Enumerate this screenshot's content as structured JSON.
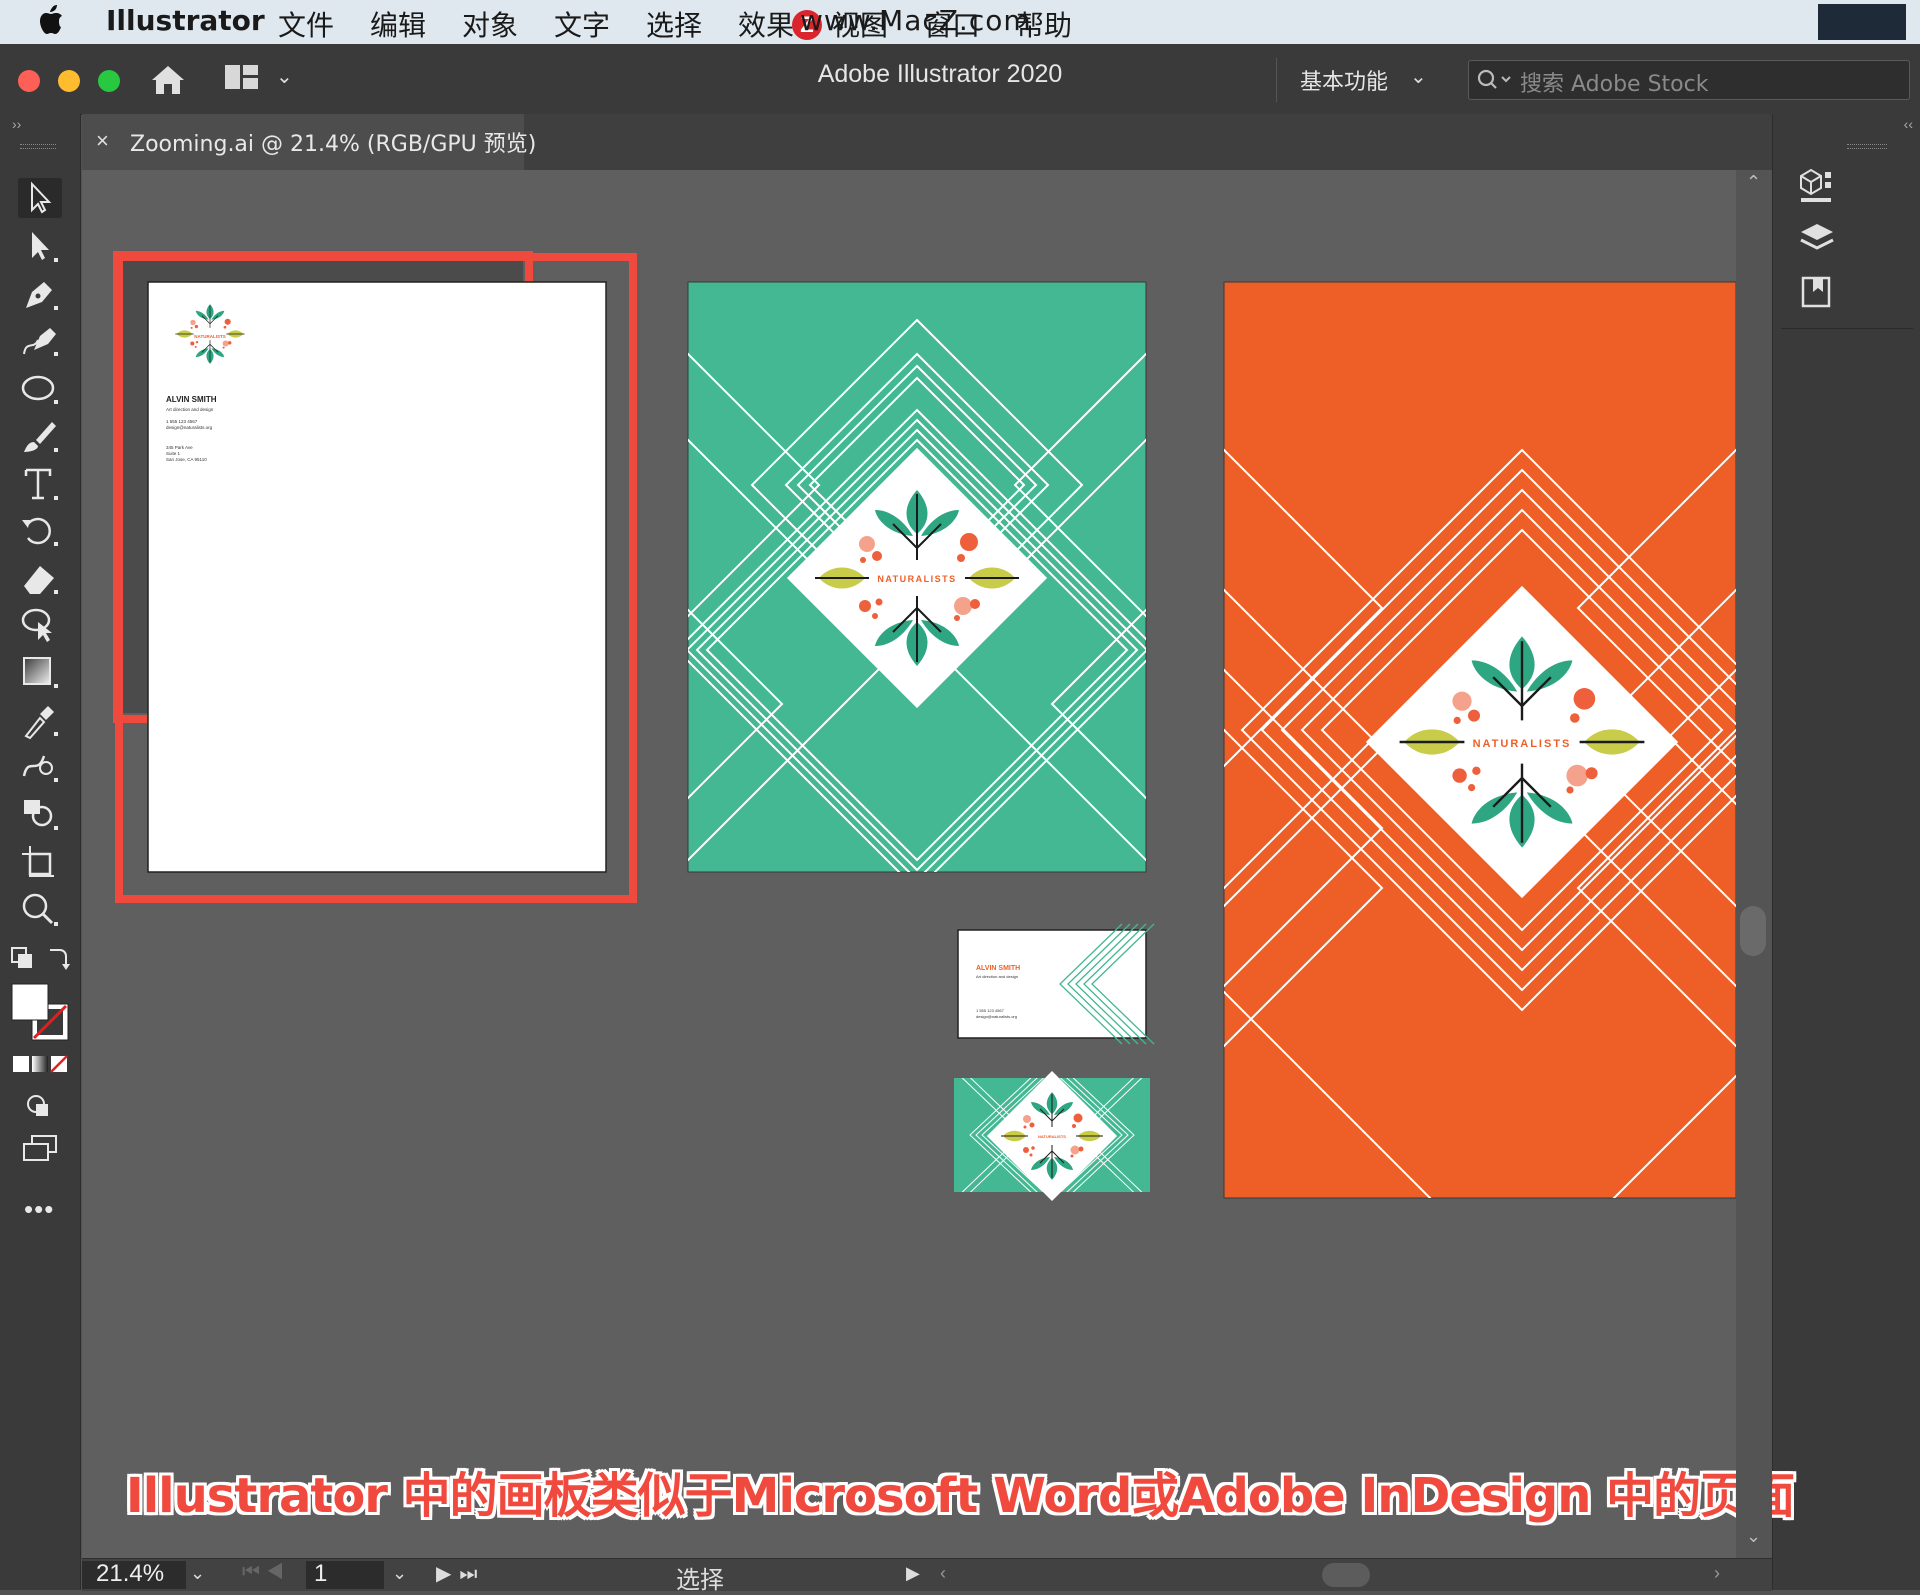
{
  "menubar": {
    "apple": "",
    "app_name": "Illustrator",
    "items": [
      "文件",
      "编辑",
      "对象",
      "文字",
      "选择",
      "效果",
      "视图",
      "窗口",
      "帮助"
    ],
    "watermark": "www.MacZ.com",
    "watermark_logo": "Z"
  },
  "titlebar": {
    "title": "Adobe Illustrator 2020",
    "workspace": "基本功能",
    "search_placeholder": "搜索 Adobe Stock"
  },
  "document_tab": {
    "close": "×",
    "label": "Zooming.ai @ 21.4% (RGB/GPU 预览)"
  },
  "artboards": {
    "letterhead": {
      "name": "ALVIN SMITH",
      "subtitle": "Art direction and design",
      "phone": "1 555 123 4567",
      "email": "design@naturalists.org",
      "address": [
        "345 Park Ave",
        "Suite 1",
        "San Jose, CA 95110"
      ]
    },
    "brand": "NATURALISTS",
    "business_card": {
      "name": "ALVIN SMITH",
      "subtitle": "Art direction and design",
      "phone": "1 555 123 4567",
      "email": "design@naturalists.org"
    }
  },
  "statusbar": {
    "zoom": "21.4%",
    "page": "1",
    "mode": "选择"
  },
  "caption": "Illustrator 中的画板类似于Microsoft Word或Adobe InDesign 中的页面",
  "colors": {
    "teal": "#43b892",
    "orange": "#ee5f28",
    "highlight": "#ef4a3d",
    "leaf_green": "#2ea681",
    "leaf_yellow": "#c8cc48",
    "dot_red": "#ee5f3c"
  },
  "tools": [
    "selection-tool",
    "direct-selection-tool",
    "pen-tool",
    "curvature-tool",
    "ellipse-tool",
    "paintbrush-tool",
    "type-tool",
    "rotate-tool",
    "eraser-tool",
    "puppet-warp-tool",
    "gradient-tool",
    "eyedropper-tool",
    "blend-tool",
    "shape-builder-tool",
    "artboard-tool",
    "zoom-tool"
  ]
}
